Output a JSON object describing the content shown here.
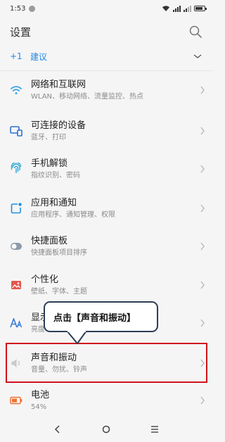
{
  "status_bar": {
    "time": "1:53",
    "battery_level": 0.85
  },
  "header": {
    "title": "设置",
    "search_icon": "search-icon"
  },
  "suggestion": {
    "count": "+1",
    "label": "建议"
  },
  "accent_color": "#1e88e5",
  "highlight_color": "#d0121c",
  "settings_items": [
    {
      "name": "network",
      "icon": "wifi-icon",
      "color": "#3aa3e3",
      "title": "网络和互联网",
      "subtitle": "WLAN、移动网络、流量监控、热点"
    },
    {
      "name": "connected-devices",
      "icon": "devices-icon",
      "color": "#2f6fd1",
      "title": "可连接的设备",
      "subtitle": "蓝牙、打印"
    },
    {
      "name": "unlock",
      "icon": "fingerprint-icon",
      "color": "#2aa6d8",
      "title": "手机解锁",
      "subtitle": "指纹识别、密码"
    },
    {
      "name": "apps-notifications",
      "icon": "notification-icon",
      "color": "#1f8fe0",
      "title": "应用和通知",
      "subtitle": "应用程序、通知管理、权限"
    },
    {
      "name": "quick-panel",
      "icon": "toggle-icon",
      "color": "#8c9aa8",
      "title": "快捷面板",
      "subtitle": "快捷面板项目排序"
    },
    {
      "name": "personalization",
      "icon": "image-icon",
      "color": "#e2584f",
      "title": "个性化",
      "subtitle": "壁纸、字体、主题"
    },
    {
      "name": "display",
      "icon": "text-size-icon",
      "color": "#3a7bd5",
      "title": "显示",
      "subtitle": "亮度"
    },
    {
      "name": "sound-vibration",
      "icon": "speaker-icon",
      "color": "#c9c9c9",
      "title": "声音和振动",
      "subtitle": "音量、勿扰、铃声"
    },
    {
      "name": "battery",
      "icon": "battery-icon",
      "color": "#f0712f",
      "title": "电池",
      "subtitle": "54%"
    }
  ],
  "callout": {
    "text": "点击【声音和振动】"
  },
  "nav_bar": {
    "back_icon": "back-icon",
    "home_icon": "home-icon",
    "menu_icon": "menu-icon"
  }
}
